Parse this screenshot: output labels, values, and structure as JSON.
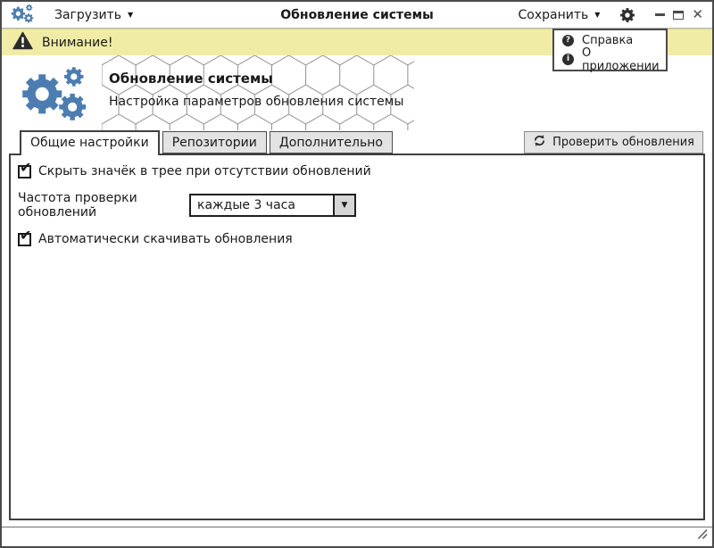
{
  "titlebar": {
    "load_menu": "Загрузить",
    "title": "Обновление системы",
    "save_menu": "Сохранить"
  },
  "icons": {
    "caret_down": "▼",
    "close_glyph": "✕",
    "check_glyph": "✔"
  },
  "warning_bar": {
    "text": "Внимание!"
  },
  "dropdown_menu": {
    "items": [
      {
        "label": "Справка",
        "glyph": "?"
      },
      {
        "label": "О приложении",
        "glyph": "i"
      }
    ]
  },
  "header": {
    "title": "Обновление системы",
    "subtitle": "Настройка параметров обновления системы"
  },
  "tabs": [
    {
      "label": "Общие настройки",
      "active": true
    },
    {
      "label": "Репозитории",
      "active": false
    },
    {
      "label": "Дополнительно",
      "active": false
    }
  ],
  "toolbar": {
    "check_updates_label": "Проверить обновления"
  },
  "settings": {
    "hide_tray": {
      "label": "Скрыть значёк в трее при отсутствии обновлений",
      "checked": true
    },
    "frequency": {
      "label": "Частота проверки обновлений",
      "value": "каждые 3 часа"
    },
    "auto_download": {
      "label": "Автоматически скачивать обновления",
      "checked": true
    }
  },
  "colors": {
    "accent_blue": "#4d7db0",
    "warning_yellow": "#f0eca6"
  }
}
